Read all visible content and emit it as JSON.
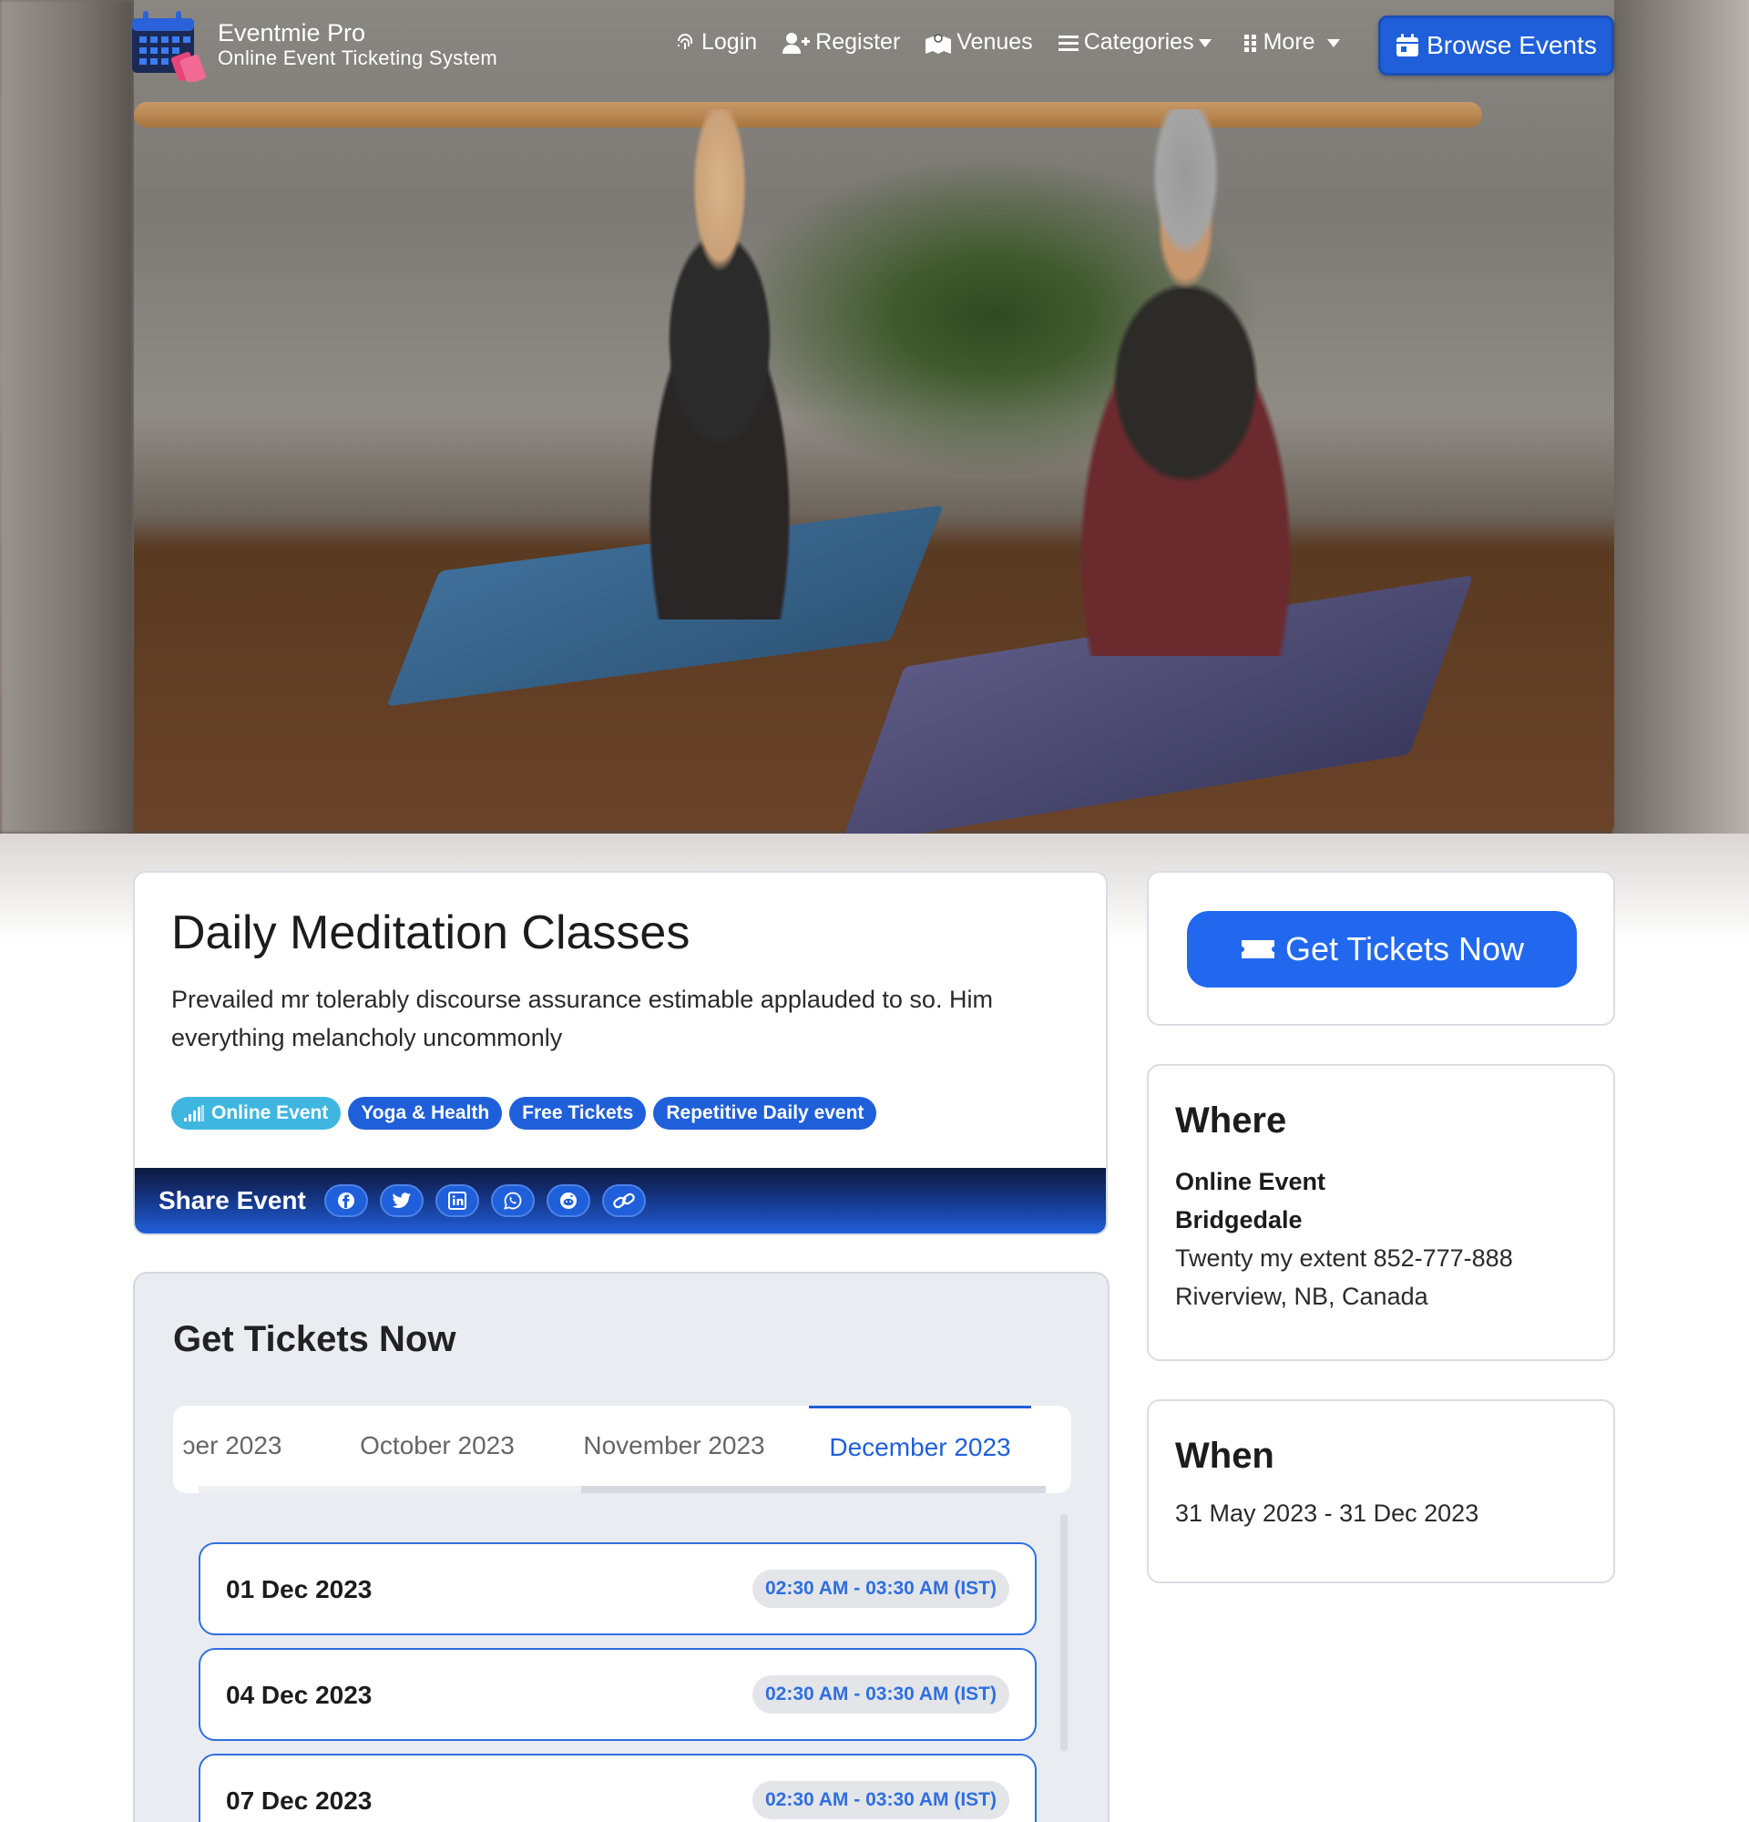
{
  "brand": {
    "title": "Eventmie Pro",
    "subtitle": "Online Event Ticketing System"
  },
  "nav": {
    "login": "Login",
    "register": "Register",
    "venues": "Venues",
    "categories": "Categories",
    "more": "More",
    "browse": "Browse Events"
  },
  "event": {
    "title": "Daily Meditation Classes",
    "description": "Prevailed mr tolerably discourse assurance estimable applauded to so. Him everything melancholy uncommonly",
    "badges": [
      "Online Event",
      "Yoga & Health",
      "Free Tickets",
      "Repetitive Daily event"
    ],
    "share_label": "Share Event"
  },
  "tickets": {
    "title": "Get Tickets Now",
    "tabs": [
      "ɔer 2023",
      "October 2023",
      "November 2023",
      "December 2023"
    ],
    "active_tab": "December 2023",
    "dates": [
      {
        "date": "01 Dec 2023",
        "time": "02:30 AM - 03:30 AM (IST)"
      },
      {
        "date": "04 Dec 2023",
        "time": "02:30 AM - 03:30 AM (IST)"
      },
      {
        "date": "07 Dec 2023",
        "time": "02:30 AM - 03:30 AM (IST)"
      }
    ]
  },
  "cta": {
    "label": "Get Tickets Now"
  },
  "where": {
    "heading": "Where",
    "venue": "Online Event",
    "place": "Bridgedale",
    "address": "Twenty my extent 852-777-888",
    "city": "Riverview, NB, Canada"
  },
  "when": {
    "heading": "When",
    "range": "31 May 2023 - 31 Dec 2023"
  },
  "colors": {
    "primary": "#1f5fd9",
    "cyan_badge": "#3fb6e0",
    "panel_bg": "#e9ecf0"
  }
}
